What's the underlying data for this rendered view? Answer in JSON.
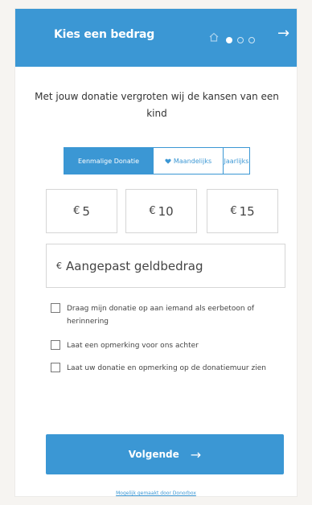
{
  "header": {
    "title": "Kies een bedrag",
    "home_icon": "home-icon",
    "steps": {
      "total": 3,
      "current": 1
    },
    "next_icon": "arrow-right-icon"
  },
  "intro": "Met jouw donatie vergroten wij de kansen van een kind",
  "frequency": {
    "options": [
      "Eenmalige Donatie",
      "Maandelijks",
      "Jaarlijks"
    ],
    "selected": "Eenmalige Donatie",
    "maandelijks_icon": "heart-icon"
  },
  "amounts": [
    {
      "currency": "€",
      "value": "5"
    },
    {
      "currency": "€",
      "value": "10"
    },
    {
      "currency": "€",
      "value": "15"
    }
  ],
  "custom_amount": {
    "currency": "€",
    "placeholder": "Aangepast geldbedrag"
  },
  "options": [
    {
      "label": "Draag mijn donatie op aan iemand als eerbetoon of herinnering",
      "checked": false
    },
    {
      "label": "Laat een opmerking voor ons achter",
      "checked": false
    },
    {
      "label": "Laat uw donatie en opmerking op de donatiemuur zien",
      "checked": false
    }
  ],
  "next_button": {
    "label": "Volgende",
    "icon": "arrow-right-icon"
  },
  "footer": {
    "powered_by": "Mogelijk gemaakt door Donorbox"
  },
  "colors": {
    "accent": "#3b97d4",
    "background": "#f6f4f1",
    "card": "#ffffff"
  }
}
